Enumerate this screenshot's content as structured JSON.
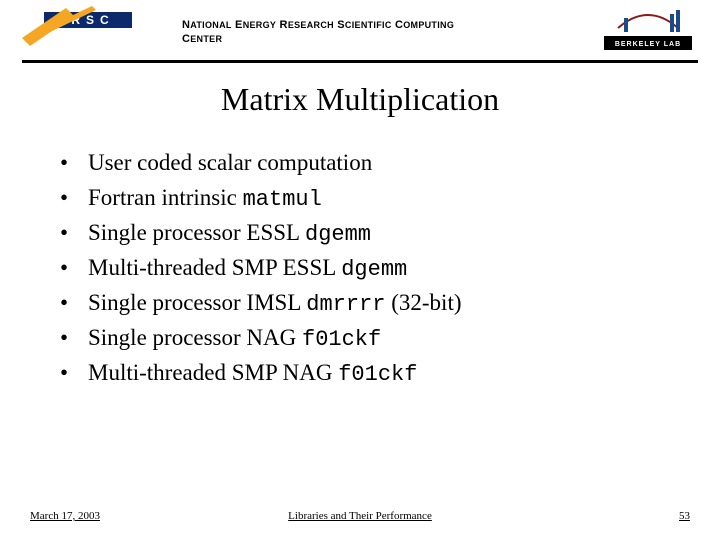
{
  "header": {
    "org_html": "N<span style='font-size:9px'>ATIONAL</span> E<span style='font-size:9px'>NERGY</span> R<span style='font-size:9px'>ESEARCH</span> S<span style='font-size:9px'>CIENTIFIC</span> C<span style='font-size:9px'>OMPUTING</span><br>C<span style='font-size:9px'>ENTER</span>",
    "left_logo_text": "ERSC",
    "right_logo_text": "BERKELEY LAB"
  },
  "title": "Matrix Multiplication",
  "bullets": [
    {
      "text": "User coded scalar computation",
      "code": ""
    },
    {
      "text": "Fortran intrinsic ",
      "code": "matmul"
    },
    {
      "text": "Single processor ESSL ",
      "code": "dgemm"
    },
    {
      "text": "Multi-threaded SMP ESSL ",
      "code": "dgemm"
    },
    {
      "text": "Single processor IMSL ",
      "code": "dmrrrr",
      "suffix": " (32-bit)"
    },
    {
      "text": "Single processor NAG ",
      "code": "f01ckf"
    },
    {
      "text": "Multi-threaded SMP NAG ",
      "code": "f01ckf"
    }
  ],
  "footer": {
    "date": "March 17, 2003",
    "title": "Libraries and Their Performance",
    "page": "53"
  }
}
